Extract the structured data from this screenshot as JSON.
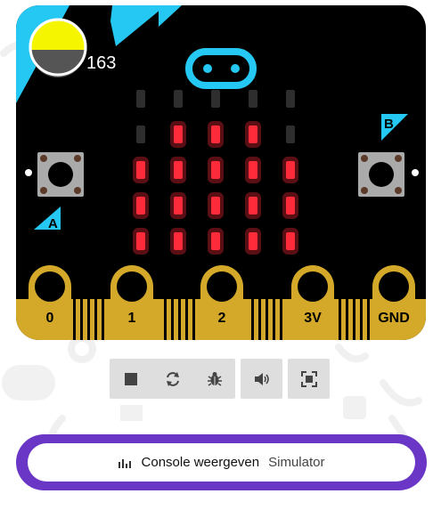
{
  "simulator": {
    "light_level": "163",
    "logo_icon": "touch-logo-icon",
    "led_color": "#ff2b3a",
    "led_matrix": [
      [
        0,
        0,
        0,
        0,
        0
      ],
      [
        0,
        1,
        1,
        1,
        0
      ],
      [
        1,
        1,
        1,
        1,
        1
      ],
      [
        1,
        1,
        1,
        1,
        1
      ],
      [
        1,
        1,
        1,
        1,
        1
      ]
    ],
    "buttons": {
      "a": "A",
      "b": "B"
    },
    "pins": [
      "0",
      "1",
      "2",
      "3V",
      "GND"
    ],
    "colors": {
      "board": "#000000",
      "edge": "#d4a92a",
      "accent": "#25c8f2",
      "light_sensor": "#f5f500"
    }
  },
  "toolbar": {
    "buttons": [
      "stop-icon",
      "restart-icon",
      "debug-icon",
      "sound-icon",
      "fullscreen-icon"
    ]
  },
  "console": {
    "icon": "bar-chart-icon",
    "label": "Console weergeven",
    "sublabel": "Simulator",
    "border_color": "#6a36c5"
  }
}
